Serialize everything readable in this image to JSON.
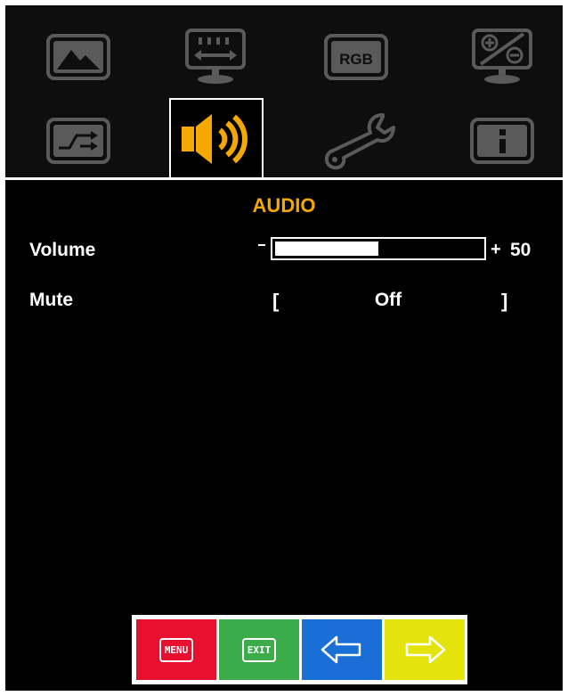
{
  "tabs": [
    {
      "name": "picture",
      "icon": "picture-icon"
    },
    {
      "name": "display",
      "icon": "display-adjust-icon"
    },
    {
      "name": "color",
      "icon": "rgb-icon",
      "label": "RGB"
    },
    {
      "name": "osd-settings",
      "icon": "osd-adjust-icon"
    },
    {
      "name": "input",
      "icon": "input-switch-icon"
    },
    {
      "name": "audio",
      "icon": "speaker-icon",
      "selected": true
    },
    {
      "name": "setup",
      "icon": "wrench-icon"
    },
    {
      "name": "information",
      "icon": "info-icon",
      "label": "i"
    }
  ],
  "colors": {
    "accent": "#f5a800",
    "tab_icon": "#5a5a5a",
    "menu_button": "#e8102e",
    "exit_button": "#3cab4a",
    "left_button": "#1a6fd6",
    "right_button": "#e4e40c"
  },
  "menu": {
    "title": "AUDIO",
    "volume": {
      "label": "Volume",
      "minus": "–",
      "plus": "+",
      "value": "50",
      "level_percent": 50
    },
    "mute": {
      "label": "Mute",
      "bracket_left": "[",
      "value": "Off",
      "bracket_right": "]"
    }
  },
  "footer": {
    "menu_label": "MENU",
    "exit_label": "EXIT",
    "left_icon": "left-arrow-icon",
    "right_icon": "right-arrow-icon"
  }
}
